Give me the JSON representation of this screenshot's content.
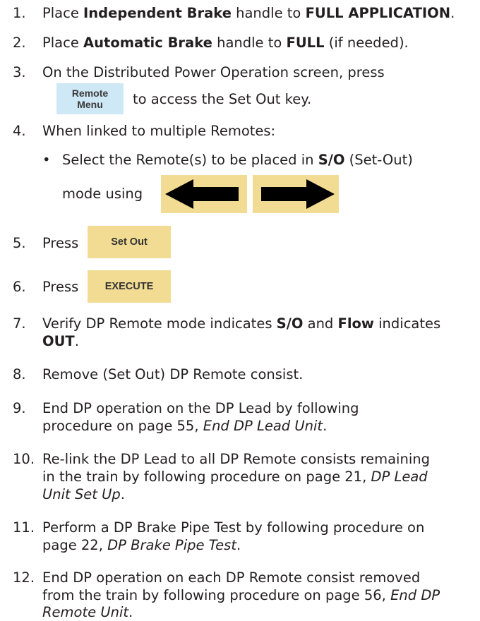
{
  "steps": [
    {
      "num": "1.",
      "parts": [
        "Place ",
        "Independent Brake",
        " handle to ",
        "FULL APPLICATION",
        "."
      ]
    },
    {
      "num": "2.",
      "parts": [
        "Place ",
        "Automatic Brake",
        " handle to ",
        "FULL",
        " (if needed)."
      ]
    },
    {
      "num": "3.",
      "line1": "On the Distributed Power Operation screen, press",
      "key_line1": "Remote",
      "key_line2": "Menu",
      "after": "to access the Set Out key."
    },
    {
      "num": "4.",
      "text": "When linked to multiple Remotes:",
      "bullet": "•",
      "sub_parts": [
        "Select the Remote(s) to be placed in ",
        "S/O",
        " (Set-Out)"
      ],
      "sub_line2": "mode using",
      "left_arrow": "left-arrow-icon",
      "right_arrow": "right-arrow-icon"
    },
    {
      "num": "5.",
      "text": "Press",
      "key": "Set Out"
    },
    {
      "num": "6.",
      "text": "Press",
      "key": "EXECUTE"
    },
    {
      "num": "7.",
      "parts": [
        "Verify DP Remote mode indicates ",
        "S/O",
        " and ",
        "Flow",
        " indicates"
      ],
      "line2": "OUT",
      "line2_end": "."
    },
    {
      "num": "8.",
      "text": "Remove (Set Out) DP Remote consist."
    },
    {
      "num": "9.",
      "line1": "End DP operation on the DP Lead by following",
      "line2": "procedure on page 55, ",
      "line2_italic": "End DP Lead Unit",
      "line2_end": "."
    },
    {
      "num": "10.",
      "line1": "Re-link the DP Lead to all DP Remote consists remaining",
      "line2": "in the train by following procedure on page 21, ",
      "line2_italic": "DP Lead",
      "line3_italic": "Unit Set Up",
      "line3_end": "."
    },
    {
      "num": "11.",
      "line1": "Perform a DP Brake Pipe Test by following procedure on",
      "line2": "page 22, ",
      "line2_italic": "DP Brake Pipe Test",
      "line2_end": "."
    },
    {
      "num": "12.",
      "line1": "End DP operation on each DP Remote consist removed",
      "line2": "from the train by following procedure on page 56, ",
      "line2_italic": "End DP",
      "line3_italic": "Remote Unit",
      "line3_end": "."
    }
  ],
  "colors": {
    "key_blue": "#cfe8f6",
    "key_tan": "#f2dc93",
    "text": "#231f20",
    "arrow": "#000000"
  }
}
